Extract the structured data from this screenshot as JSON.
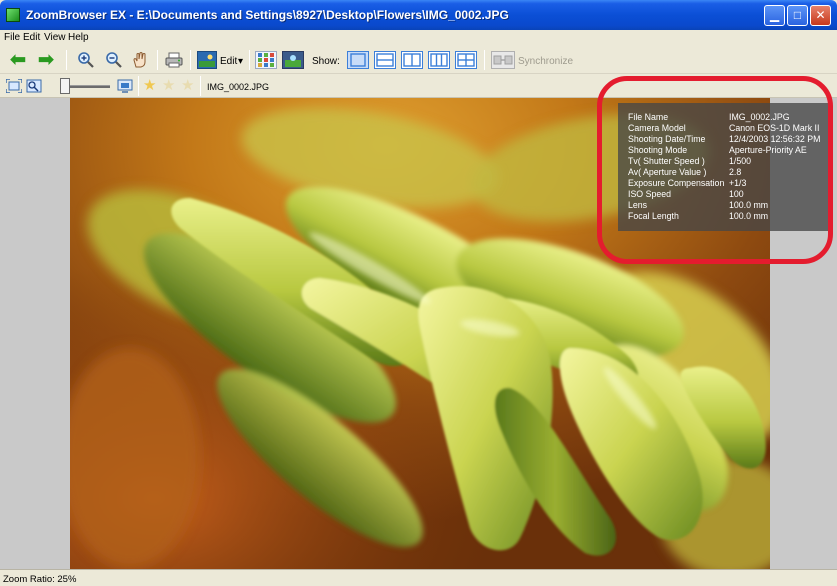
{
  "window": {
    "title": "ZoomBrowser EX - E:\\Documents and Settings\\8927\\Desktop\\Flowers\\IMG_0002.JPG",
    "min_glyph": "▁",
    "max_glyph": "□",
    "close_glyph": "✕"
  },
  "menu": {
    "items": [
      "File",
      "Edit",
      "View",
      "Help"
    ]
  },
  "toolbar": {
    "edit_label": "Edit",
    "edit_caret": "▾",
    "show_label": "Show:",
    "sync_label": "Synchronize",
    "icons": {
      "back": "back-arrow-icon",
      "forward": "forward-arrow-icon",
      "zoom_in": "zoom-in-icon",
      "zoom_out": "zoom-out-icon",
      "hand": "hand-pan-icon",
      "print": "printer-icon",
      "edit": "edit-image-icon",
      "thumbs": "thumbnail-grid-icon",
      "photo_view": "photo-view-icon"
    }
  },
  "toolbar2": {
    "filename": "IMG_0002.JPG",
    "rating_stars": 3,
    "star_glyph": "★"
  },
  "info": {
    "rows": [
      {
        "key": "File Name",
        "value": "IMG_0002.JPG"
      },
      {
        "key": "Camera Model",
        "value": "Canon EOS-1D Mark II"
      },
      {
        "key": "Shooting Date/Time",
        "value": "12/4/2003 12:56:32 PM"
      },
      {
        "key": "Shooting Mode",
        "value": "Aperture-Priority AE"
      },
      {
        "key": "Tv( Shutter Speed )",
        "value": "1/500"
      },
      {
        "key": "Av( Aperture Value )",
        "value": "2.8"
      },
      {
        "key": "Exposure Compensation",
        "value": "+1/3"
      },
      {
        "key": "ISO Speed",
        "value": "100"
      },
      {
        "key": "Lens",
        "value": "100.0 mm"
      },
      {
        "key": "Focal Length",
        "value": "100.0 mm"
      }
    ]
  },
  "status": {
    "zoom_text": "Zoom Ratio: 25%"
  },
  "colors": {
    "titlebar": "#0b4fd6",
    "annotation_ring": "#e41c2e",
    "arrow_green": "#2a9a20"
  }
}
